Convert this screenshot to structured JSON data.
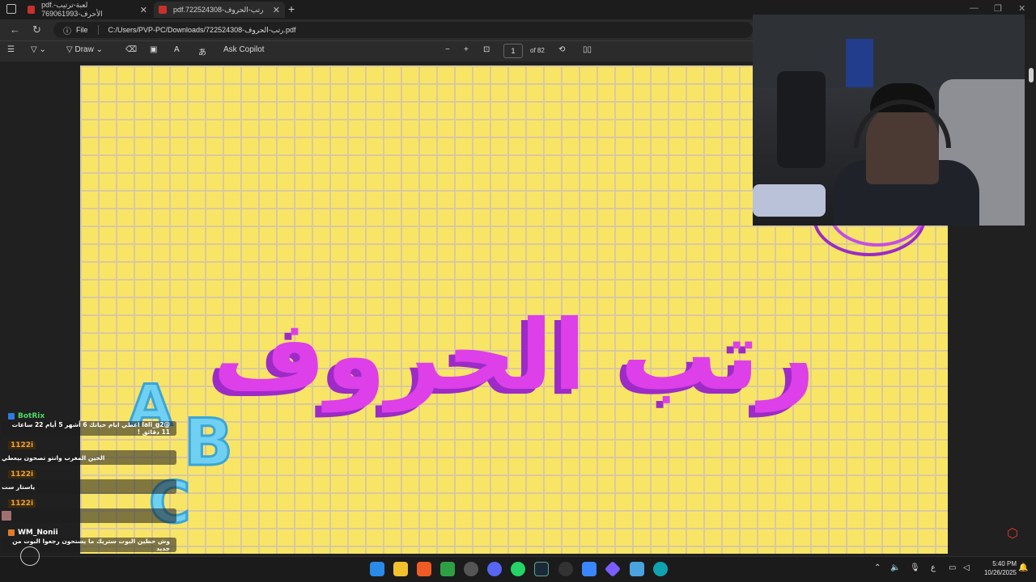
{
  "tabs": [
    {
      "label": "pdf.لعبة-ترتيب-الأحرف-769061993"
    },
    {
      "label": "pdf.رتب-الحروف-722524308"
    }
  ],
  "address": {
    "file_label": "File",
    "path": "C:/Users/PVP-PC/Downloads/722524308-رتب-الحروف.pdf"
  },
  "toolbar": {
    "draw_label": "Draw",
    "ask_copilot": "Ask Copilot",
    "page_current": "1",
    "page_total": "of 82"
  },
  "page": {
    "headline": "رتب الحروف",
    "bubbles": [
      "A",
      "B",
      "C"
    ]
  },
  "chat": [
    {
      "user": "BotRix",
      "color": "#4cd964",
      "message": "@lali_g2 اعطي ايام حياتك 6 أشهر 5 أيام 22 ساعات 11 دقائق !"
    },
    {
      "user": "1122i",
      "color": "#f2a33a",
      "message": "الحين المغرب وانتو تصحون بيعطي"
    },
    {
      "user": "1122i",
      "color": "#f2a33a",
      "message": "ياستار ست"
    },
    {
      "user": "1122i",
      "color": "#f2a33a",
      "message": ""
    },
    {
      "user": "WM_Nonii",
      "color": "#ffffff",
      "message": "وش حظين البوت ستريك ما يستحون رجعوا البوت من جديد"
    }
  ],
  "clock": {
    "time": "5:40 PM",
    "date": "10/26/2025"
  },
  "tray": {
    "lang": "ع"
  }
}
